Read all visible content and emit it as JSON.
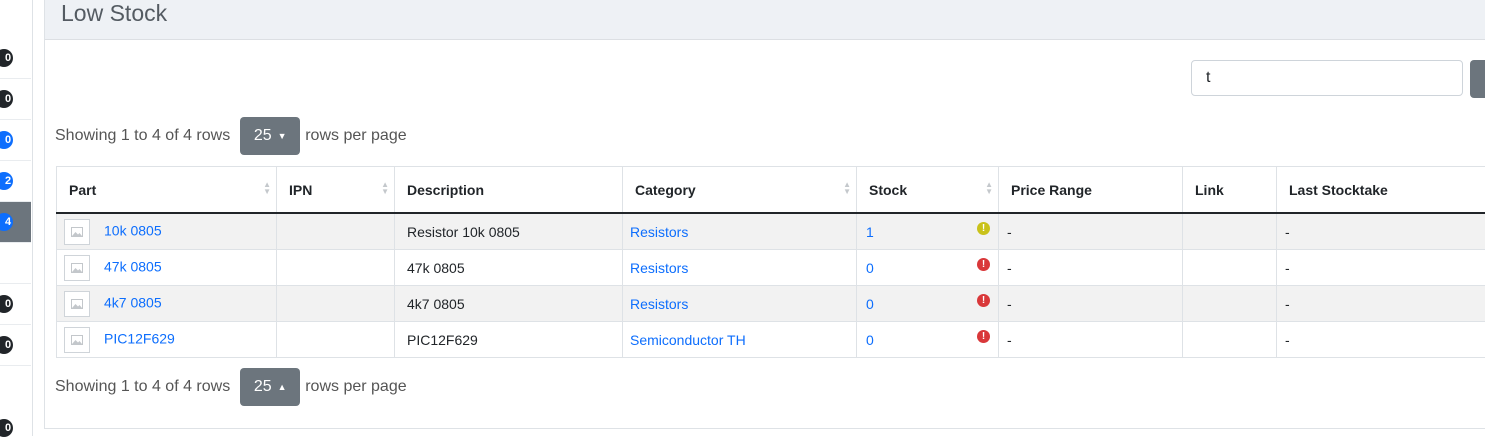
{
  "sidebar": {
    "badges": [
      "0",
      "0",
      "0",
      "2",
      "4",
      "",
      "0",
      "0",
      "0"
    ]
  },
  "panel": {
    "title": "Low Stock"
  },
  "search": {
    "value": "t",
    "placeholder": ""
  },
  "pagination": {
    "info_text": "Showing 1 to 4 of 4 rows",
    "page_size": "25",
    "suffix": "rows per page"
  },
  "table": {
    "columns": [
      "Part",
      "IPN",
      "Description",
      "Category",
      "Stock",
      "Price Range",
      "Link",
      "Last Stocktake"
    ],
    "rows": [
      {
        "part": "10k 0805",
        "ipn": "",
        "description": "Resistor 10k 0805",
        "category": "Resistors",
        "stock": "1",
        "stock_status": "low",
        "price_range": "-",
        "link": "",
        "last_stocktake": "-"
      },
      {
        "part": "47k 0805",
        "ipn": "",
        "description": "47k 0805",
        "category": "Resistors",
        "stock": "0",
        "stock_status": "empty",
        "price_range": "-",
        "link": "",
        "last_stocktake": "-"
      },
      {
        "part": "4k7 0805",
        "ipn": "",
        "description": "4k7 0805",
        "category": "Resistors",
        "stock": "0",
        "stock_status": "empty",
        "price_range": "-",
        "link": "",
        "last_stocktake": "-"
      },
      {
        "part": "PIC12F629",
        "ipn": "",
        "description": "PIC12F629",
        "category": "Semiconductor TH",
        "stock": "0",
        "stock_status": "empty",
        "price_range": "-",
        "link": "",
        "last_stocktake": "-"
      }
    ]
  },
  "colors": {
    "link": "#0d6efd",
    "warning": "#c9c21b",
    "danger": "#d9383a",
    "button": "#6c757d"
  }
}
